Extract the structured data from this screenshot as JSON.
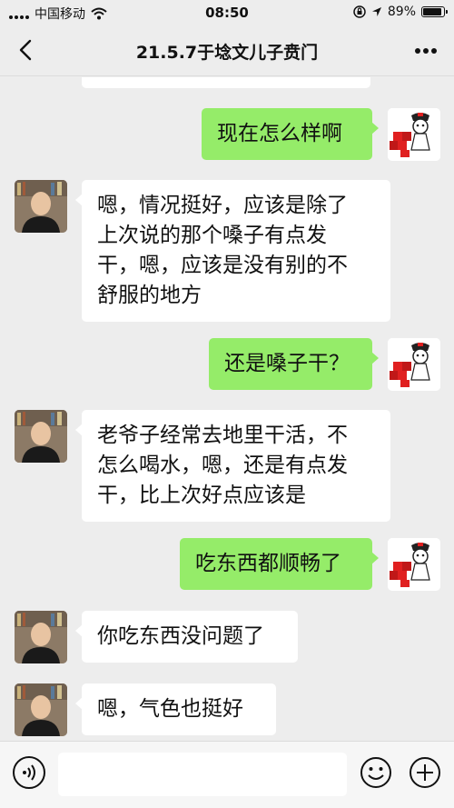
{
  "status_bar": {
    "carrier": "中国移动",
    "time": "08:50",
    "battery_text": "89%",
    "battery_level": 0.89,
    "icons": [
      "signal-icon",
      "wifi-icon",
      "rotation-lock-icon",
      "location-icon",
      "battery-icon"
    ]
  },
  "nav": {
    "back_icon": "back-arrow-icon",
    "title": "21.5.7于埝文儿子贲门",
    "more_icon": "more-dots-icon"
  },
  "messages": [
    {
      "side": "right",
      "text": "现在怎么样啊"
    },
    {
      "side": "left",
      "lines": [
        "嗯，情况挺好，应该是除了",
        "上次说的那个嗓子有点发",
        "干，嗯，应该是没有别的不",
        "舒服的地方"
      ]
    },
    {
      "side": "right",
      "text": "还是嗓子干？"
    },
    {
      "side": "left",
      "lines": [
        "老爷子经常去地里干活，不",
        "怎么喝水，嗯，还是有点发",
        "干，比上次好点应该是"
      ]
    },
    {
      "side": "right",
      "text": "吃东西都顺畅了"
    },
    {
      "side": "left",
      "text": "你吃东西没问题了"
    },
    {
      "side": "left",
      "text": "嗯，气色也挺好"
    }
  ],
  "input_bar": {
    "voice_icon": "voice-icon",
    "input_value": "",
    "emoji_icon": "emoji-icon",
    "plus_icon": "plus-icon"
  },
  "colors": {
    "background": "#ededed",
    "outgoing_bubble": "#95ec69",
    "incoming_bubble": "#ffffff"
  }
}
